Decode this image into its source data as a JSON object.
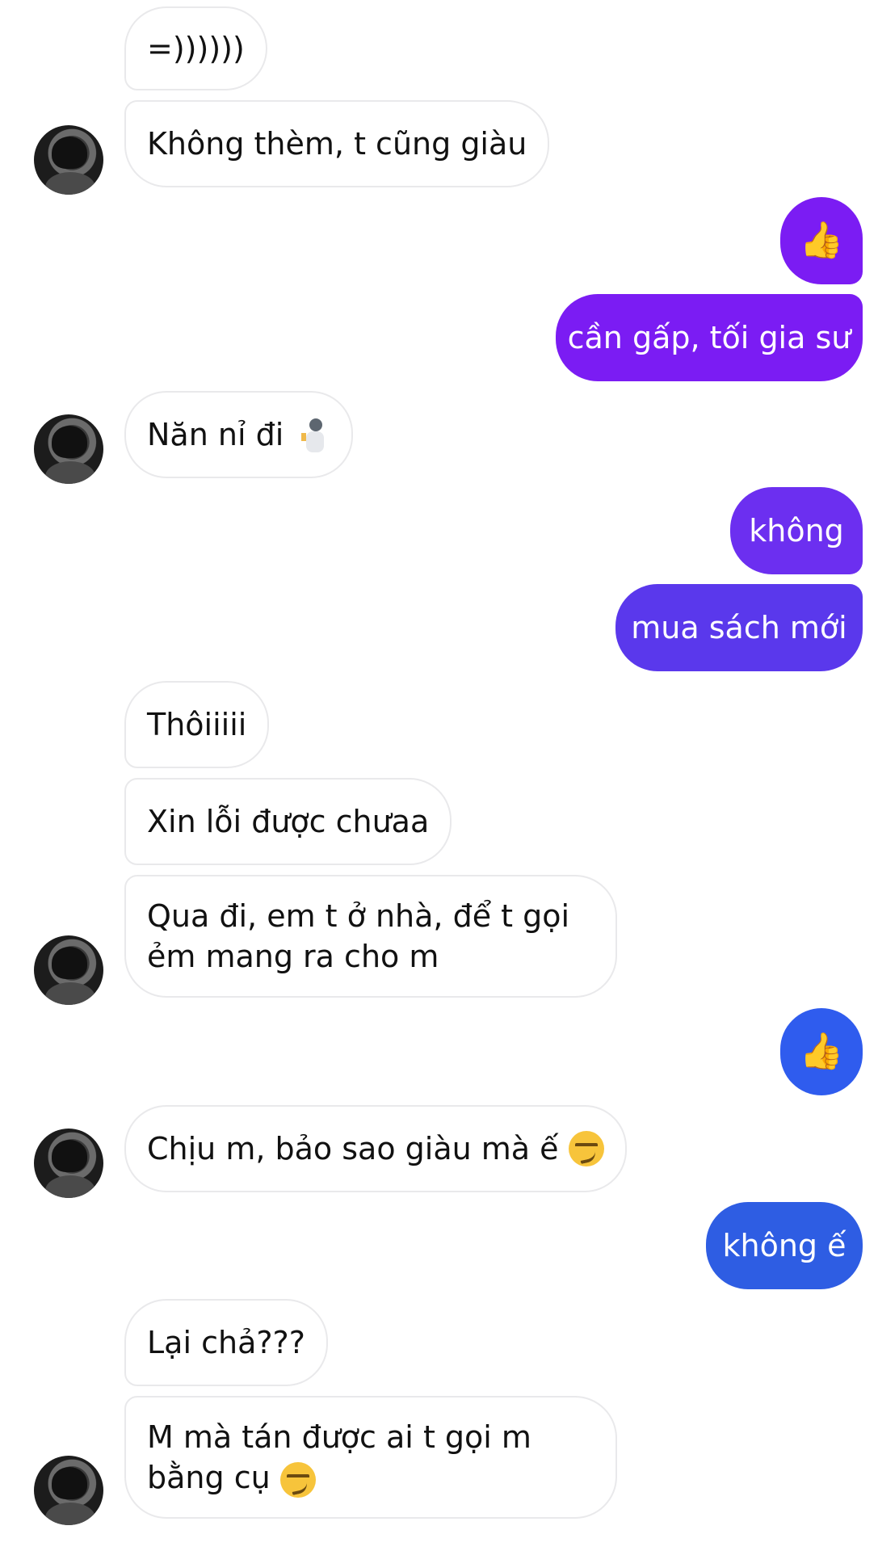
{
  "messages": [
    {
      "id": "m1",
      "side": "in",
      "text": "=))))))"
    },
    {
      "id": "m2",
      "side": "in",
      "text": "Không thèm, t cũng giàu"
    },
    {
      "id": "m3",
      "side": "out",
      "type": "thumb",
      "icon": "thumbs-up-icon"
    },
    {
      "id": "m4",
      "side": "out",
      "text": "cần gấp, tối gia sư"
    },
    {
      "id": "m5",
      "side": "in",
      "text": "Năn nỉ đi",
      "emoji": "fencer-emoji"
    },
    {
      "id": "m6",
      "side": "out",
      "text": "không"
    },
    {
      "id": "m7",
      "side": "out",
      "text": "mua sách mới"
    },
    {
      "id": "m8",
      "side": "in",
      "text": "Thôiiiii"
    },
    {
      "id": "m9",
      "side": "in",
      "text": "Xin lỗi được chưaa"
    },
    {
      "id": "m10",
      "side": "in",
      "text": "Qua đi, em t ở nhà, để t gọi ẻm mang ra cho m"
    },
    {
      "id": "m11",
      "side": "out",
      "type": "thumb",
      "icon": "thumbs-up-icon"
    },
    {
      "id": "m12",
      "side": "in",
      "text": "Chịu m, bảo sao giàu mà ế",
      "emoji": "smirk-emoji"
    },
    {
      "id": "m13",
      "side": "out",
      "text": "không ế"
    },
    {
      "id": "m14",
      "side": "in",
      "text": "Lại chả???"
    },
    {
      "id": "m15",
      "side": "in",
      "text": "M mà tán được ai t gọi m bằng cụ",
      "emoji": "smirk-emoji"
    }
  ],
  "colors": {
    "incoming_bg": "#ffffff",
    "incoming_border": "#e9e9eb",
    "outgoing_purple": "#7b1cf3",
    "outgoing_violet": "#6c2ff0",
    "outgoing_indigo": "#5a38ec",
    "outgoing_blue": "#2f5cee",
    "outgoing_royal": "#2e5de3",
    "thumb_yellow": "#f6b93b"
  }
}
